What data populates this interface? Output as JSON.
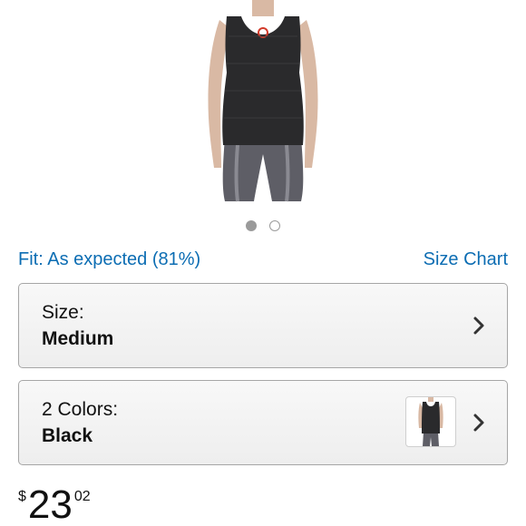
{
  "product": {
    "image_alt_icon": "product-photo-tank-top",
    "carousel": {
      "total": 2,
      "active": 1
    }
  },
  "fit": {
    "text": "Fit: As expected (81%)",
    "size_chart_label": "Size Chart"
  },
  "size_selector": {
    "label": "Size:",
    "value": "Medium"
  },
  "color_selector": {
    "label": "2 Colors:",
    "value": "Black"
  },
  "price": {
    "symbol": "$",
    "whole": "23",
    "fraction": "02"
  },
  "colors": {
    "link": "#0c6db3",
    "border": "#a6a6a6",
    "text": "#111111"
  }
}
